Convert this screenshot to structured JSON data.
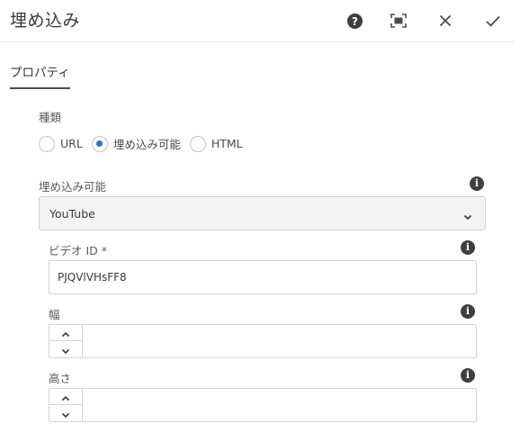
{
  "header": {
    "title": "埋め込み",
    "help_icon": "help-icon",
    "fullscreen_icon": "fullscreen-icon",
    "close_icon": "close-icon",
    "done_icon": "check-icon"
  },
  "tabs": [
    {
      "label": "プロパティ",
      "active": true
    }
  ],
  "type_field": {
    "label": "種類",
    "options": [
      {
        "label": "URL",
        "selected": false
      },
      {
        "label": "埋め込み可能",
        "selected": true
      },
      {
        "label": "HTML",
        "selected": false
      }
    ]
  },
  "embeddable_field": {
    "label": "埋め込み可能",
    "value": "YouTube"
  },
  "video_id_field": {
    "label": "ビデオ ID *",
    "value": "PJQVlVHsFF8",
    "placeholder": ""
  },
  "width_field": {
    "label": "幅",
    "value": ""
  },
  "height_field": {
    "label": "高さ",
    "value": ""
  },
  "colors": {
    "radio_selected": "#2d6fd3",
    "info_icon": "#3f3f3f",
    "border": "#d3d3d3"
  }
}
